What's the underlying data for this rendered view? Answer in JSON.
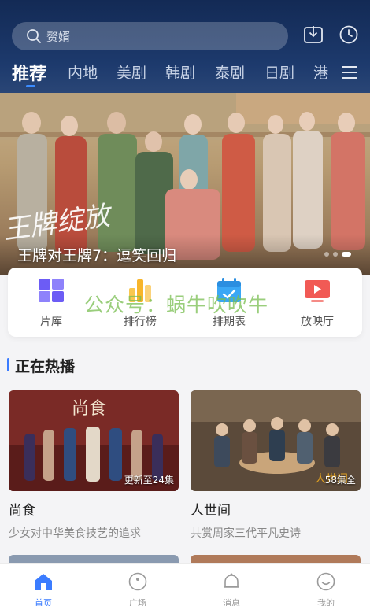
{
  "header": {
    "search_placeholder": "赘婿",
    "tabs": [
      {
        "label": "推荐",
        "active": true
      },
      {
        "label": "内地"
      },
      {
        "label": "美剧"
      },
      {
        "label": "韩剧"
      },
      {
        "label": "泰剧"
      },
      {
        "label": "日剧"
      },
      {
        "label": "港"
      }
    ],
    "icons": [
      "search-icon",
      "download-icon",
      "history-clock-icon",
      "menu-icon"
    ]
  },
  "banner": {
    "title": "王牌对王牌7：逗笑回归",
    "overlay_text": "王牌绽放",
    "dots": 3,
    "active_dot": 2
  },
  "quick_entries": [
    {
      "label": "片库",
      "icon": "library-icon",
      "color": "#6c5cf5"
    },
    {
      "label": "排行榜",
      "icon": "ranking-icon",
      "color": "#f7b52b"
    },
    {
      "label": "排期表",
      "icon": "calendar-icon",
      "color": "#3aa7f5"
    },
    {
      "label": "放映厅",
      "icon": "cinema-icon",
      "color": "#f15a55"
    }
  ],
  "watermark": "公众号：蜗牛吹吹牛",
  "section": {
    "title": "正在热播",
    "cards": [
      {
        "title": "尚食",
        "desc": "少女对中华美食技艺的追求",
        "badge": "更新至24集",
        "poster_text": "尚食"
      },
      {
        "title": "人世间",
        "desc": "共赏周家三代平凡史诗",
        "badge": "58集全",
        "poster_text": "人世间"
      }
    ]
  },
  "bottom_nav": [
    {
      "label": "首页",
      "icon": "home-icon",
      "active": true
    },
    {
      "label": "广场",
      "icon": "plaza-icon"
    },
    {
      "label": "消息",
      "icon": "bell-icon"
    },
    {
      "label": "我的",
      "icon": "profile-icon"
    }
  ],
  "colors": {
    "header_bg": "#1b3566",
    "accent": "#3b7cff",
    "text_muted": "#888888"
  }
}
